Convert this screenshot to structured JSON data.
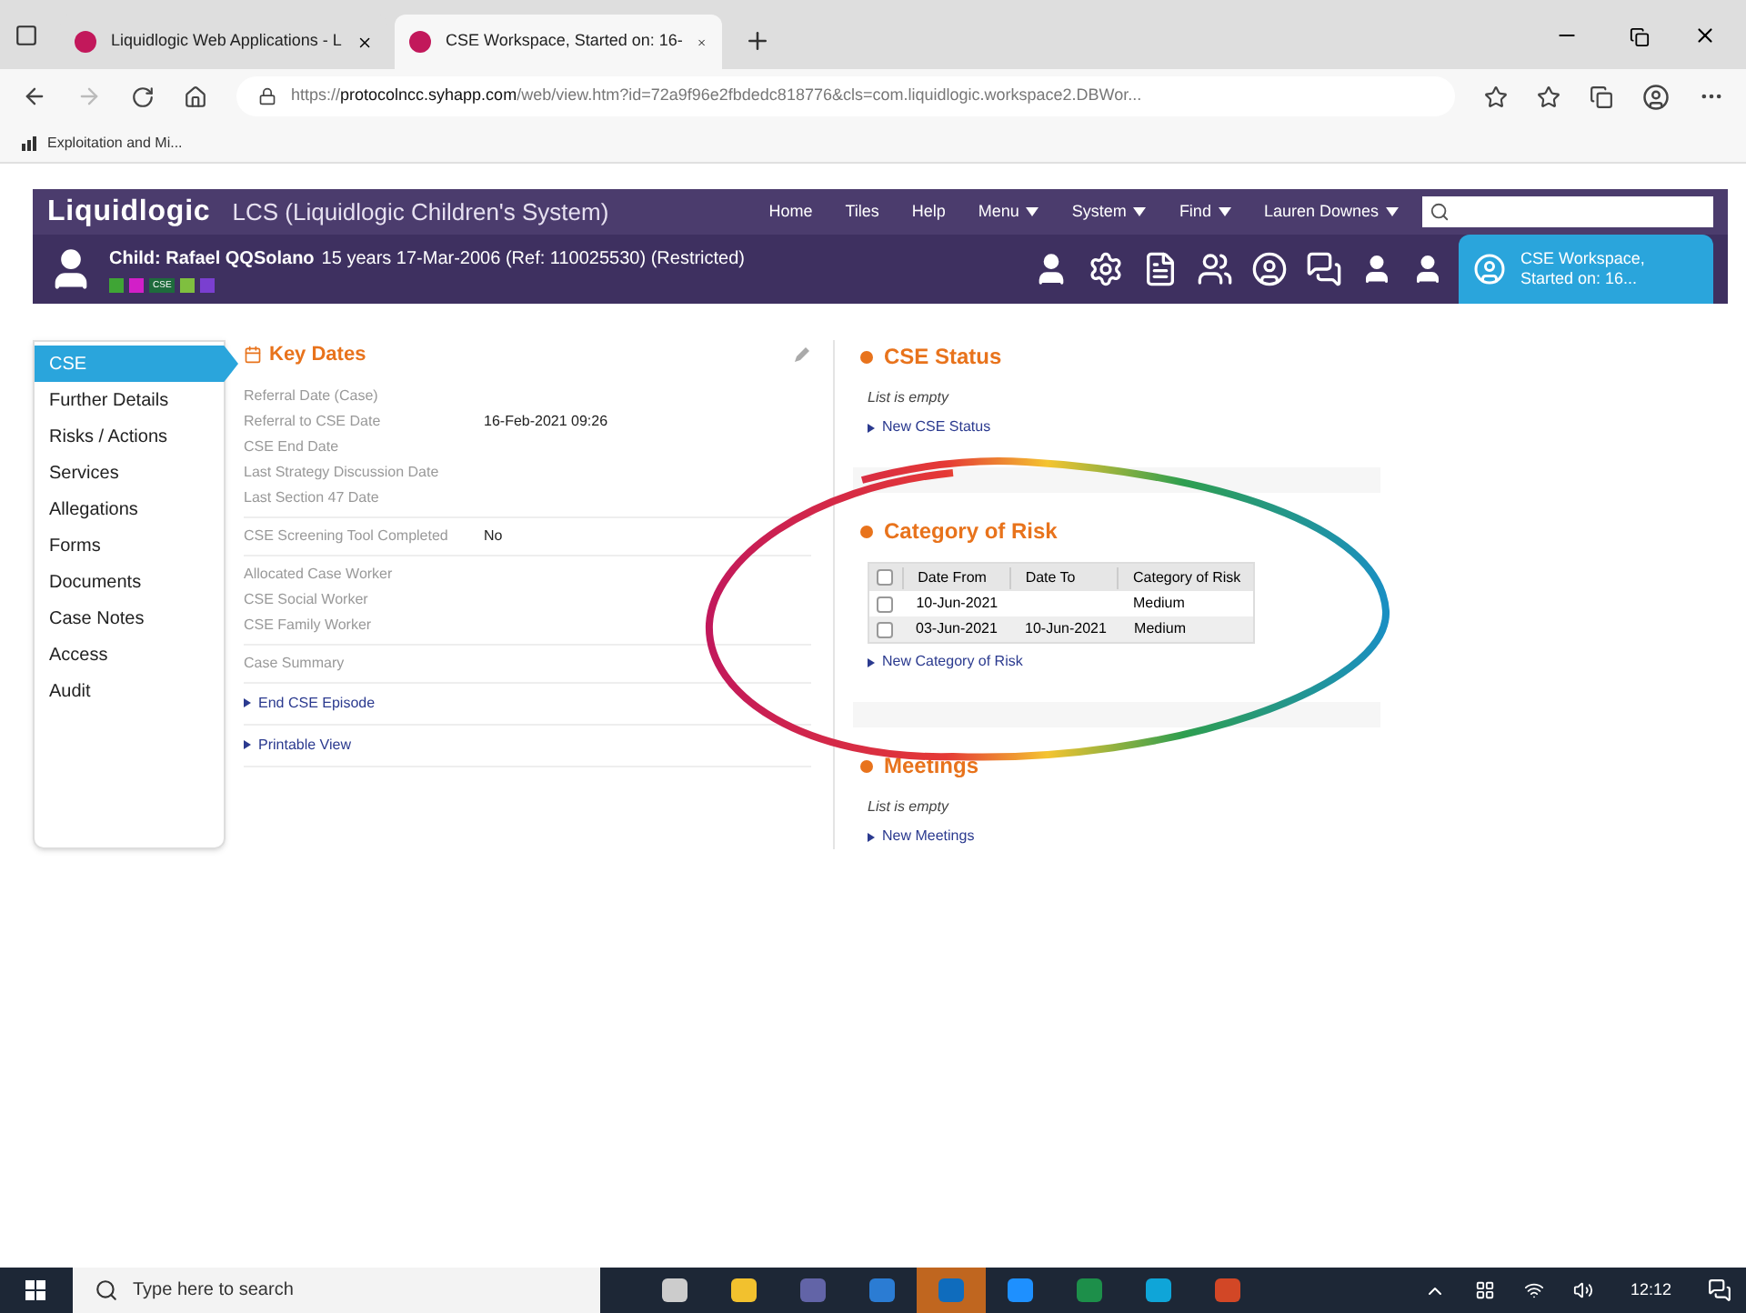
{
  "browser": {
    "tabs": [
      {
        "title": "Liquidlogic Web Applications - L",
        "selected": false
      },
      {
        "title": "CSE Workspace, Started on: 16-",
        "selected": true
      }
    ],
    "url_scheme": "https://",
    "url_host": "protocolncc.syhapp.com",
    "url_path": "/web/view.htm?id=72a9f96e2fbdedc818776&cls=com.liquidlogic.workspace2.DBWor...",
    "bookmarks": [
      "Exploitation and Mi..."
    ]
  },
  "app": {
    "brand": "Liquidlogic",
    "system_title": "LCS (Liquidlogic Children's System)",
    "nav": [
      {
        "label": "Home",
        "dropdown": false
      },
      {
        "label": "Tiles",
        "dropdown": false
      },
      {
        "label": "Help",
        "dropdown": false
      },
      {
        "label": "Menu",
        "dropdown": true
      },
      {
        "label": "System",
        "dropdown": true
      },
      {
        "label": "Find",
        "dropdown": true
      },
      {
        "label": "Lauren Downes",
        "dropdown": true
      }
    ]
  },
  "child_bar": {
    "name": "Child: Rafael QQSolano",
    "details": "15 years 17-Mar-2006 (Ref: 110025530) (Restricted)",
    "badges": [
      {
        "color": "#3fa535"
      },
      {
        "color": "#d21fc8"
      },
      {
        "label": "CSE",
        "color": "#1e6b3c"
      },
      {
        "color": "#7fbf3f"
      },
      {
        "color": "#7a3fd0"
      }
    ],
    "workspace": {
      "line1": "CSE Workspace,",
      "line2": "Started on: 16..."
    }
  },
  "sidebar": [
    {
      "label": "CSE",
      "selected": true
    },
    {
      "label": "Further Details",
      "selected": false
    },
    {
      "label": "Risks / Actions",
      "selected": false
    },
    {
      "label": "Services",
      "selected": false
    },
    {
      "label": "Allegations",
      "selected": false
    },
    {
      "label": "Forms",
      "selected": false
    },
    {
      "label": "Documents",
      "selected": false
    },
    {
      "label": "Case Notes",
      "selected": false
    },
    {
      "label": "Access",
      "selected": false
    },
    {
      "label": "Audit",
      "selected": false
    }
  ],
  "key_dates": {
    "title": "Key Dates",
    "groups": [
      [
        {
          "label": "Referral Date (Case)"
        },
        {
          "label": "Referral to CSE Date",
          "value": "16-Feb-2021 09:26"
        },
        {
          "label": "CSE End Date"
        },
        {
          "label": "Last Strategy Discussion Date"
        },
        {
          "label": "Last Section 47 Date"
        }
      ],
      [
        {
          "label": "CSE Screening Tool Completed",
          "value": "No"
        }
      ],
      [
        {
          "label": "Allocated Case Worker"
        },
        {
          "label": "CSE Social Worker"
        },
        {
          "label": "CSE Family Worker"
        }
      ],
      [
        {
          "label": "Case Summary"
        }
      ]
    ],
    "links": [
      "End CSE Episode",
      "Printable View"
    ]
  },
  "cse_status": {
    "title": "CSE Status",
    "empty_text": "List is empty",
    "link": "New CSE Status"
  },
  "category_of_risk": {
    "title": "Category of Risk",
    "columns": [
      "Date From",
      "Date To",
      "Category of Risk"
    ],
    "header_checked": false,
    "rows": [
      {
        "checked": false,
        "cells": [
          "10-Jun-2021",
          null,
          "Medium"
        ]
      },
      {
        "checked": false,
        "cells": [
          "03-Jun-2021",
          "10-Jun-2021",
          "Medium"
        ]
      }
    ],
    "link": "New Category of Risk"
  },
  "meetings": {
    "title": "Meetings",
    "empty_text": "List is empty",
    "link": "New Meetings"
  },
  "taskbar": {
    "search_placeholder": "Type here to search",
    "apps": [
      {
        "selected": false
      },
      {
        "selected": false
      },
      {
        "selected": false
      },
      {
        "selected": false
      },
      {
        "selected": true
      },
      {
        "selected": false
      },
      {
        "selected": false
      },
      {
        "selected": false
      },
      {
        "selected": false
      }
    ],
    "time": "12:12"
  }
}
